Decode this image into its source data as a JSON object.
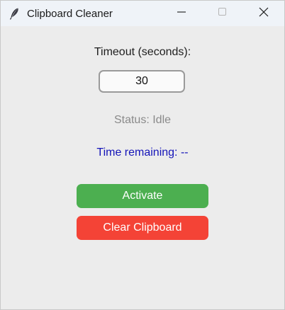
{
  "window": {
    "title": "Clipboard Cleaner",
    "icon": "feather-icon",
    "controls": {
      "minimize": "minimize-icon",
      "maximize": "maximize-icon",
      "close": "close-icon"
    }
  },
  "form": {
    "timeout_label": "Timeout (seconds):",
    "timeout_value": "30",
    "status_text": "Status: Idle",
    "time_remaining_text": "Time remaining: --"
  },
  "buttons": {
    "activate_label": "Activate",
    "clear_label": "Clear Clipboard"
  },
  "colors": {
    "activate": "#4caf50",
    "clear": "#f44336",
    "time_remaining": "#1414b8",
    "status": "#8a8a8a"
  }
}
